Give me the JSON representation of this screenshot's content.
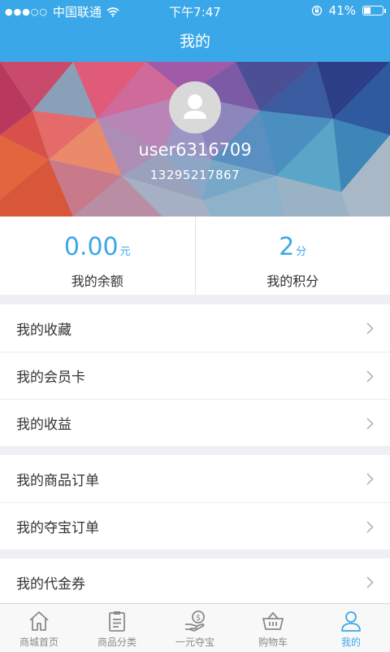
{
  "status_bar": {
    "carrier": "中国联通",
    "time": "下午7:47",
    "battery_text": "41%",
    "battery_level": 0.41
  },
  "header": {
    "title": "我的"
  },
  "profile": {
    "username": "user6316709",
    "phone": "13295217867"
  },
  "stats": {
    "balance": {
      "value": "0.00",
      "unit": "元",
      "label": "我的余额"
    },
    "points": {
      "value": "2",
      "unit": "分",
      "label": "我的积分"
    }
  },
  "menu_groups": [
    {
      "items": [
        {
          "label": "我的收藏"
        },
        {
          "label": "我的会员卡"
        },
        {
          "label": "我的收益"
        }
      ]
    },
    {
      "items": [
        {
          "label": "我的商品订单"
        },
        {
          "label": "我的夺宝订单"
        }
      ]
    },
    {
      "items": [
        {
          "label": "我的代金券"
        }
      ]
    }
  ],
  "tab_bar": {
    "items": [
      {
        "label": "商城首页",
        "icon": "home-icon"
      },
      {
        "label": "商品分类",
        "icon": "clipboard-icon"
      },
      {
        "label": "一元夺宝",
        "icon": "coin-hand-icon"
      },
      {
        "label": "购物车",
        "icon": "basket-icon"
      },
      {
        "label": "我的",
        "icon": "user-icon"
      }
    ],
    "active_index": 4
  },
  "colors": {
    "accent": "#3aa8e8",
    "background": "#efeff4"
  }
}
